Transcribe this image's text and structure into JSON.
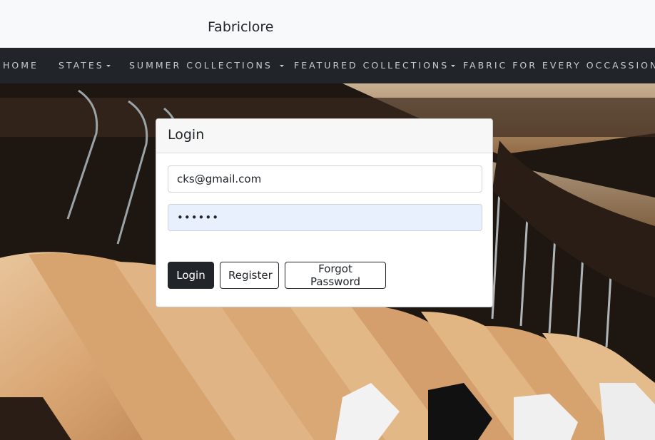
{
  "header": {
    "brand": "Fabriclore"
  },
  "nav": {
    "items": [
      {
        "label": "HOME",
        "dropdown": false
      },
      {
        "label": "STATES",
        "dropdown": true
      },
      {
        "label": "SUMMER COLLECTIONS ",
        "dropdown": true
      },
      {
        "label": "FEATURED COLLECTIONS",
        "dropdown": true
      },
      {
        "label": "FABRIC FOR EVERY OCCASSION",
        "dropdown": true
      }
    ]
  },
  "login": {
    "title": "Login",
    "email_value": "cks@gmail.com",
    "password_value": "••••••",
    "login_button": "Login",
    "register_button": "Register",
    "forgot_button": "Forgot Password"
  },
  "colors": {
    "nav_bg": "#212529",
    "topbar_bg": "#f8f9fa",
    "primary_button": "#212529",
    "autofill_bg": "#e8f0fe"
  }
}
